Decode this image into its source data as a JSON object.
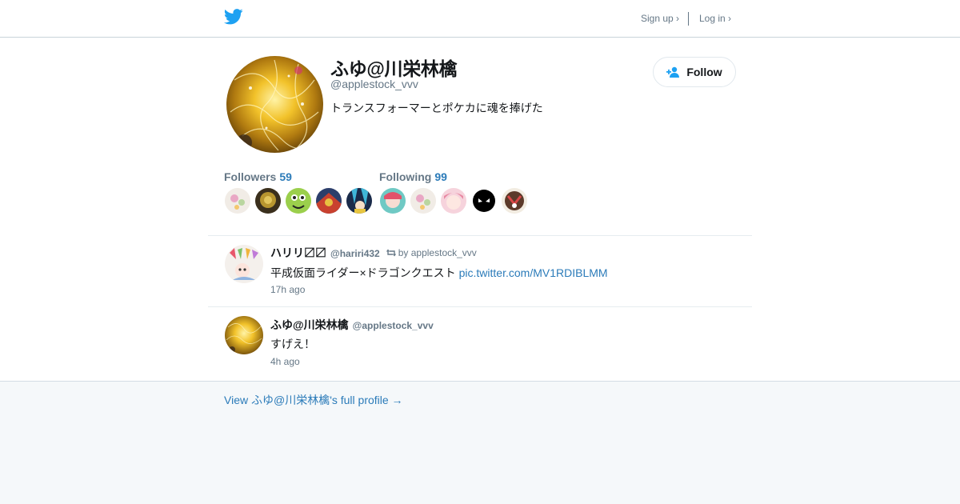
{
  "header": {
    "logo_icon": "twitter-bird-icon",
    "signup_label": "Sign up ›",
    "login_label": "Log in ›"
  },
  "profile": {
    "name": "ふゆ@川栄林檎",
    "handle": "@applestock_vvv",
    "bio": "トランスフォーマーとポケカに魂を捧げた",
    "follow_label": "Follow",
    "follow_icon": "add-user-icon"
  },
  "stats": {
    "followers_label": "Followers",
    "followers_count": "59",
    "following_label": "Following",
    "following_count": "99"
  },
  "tweets": [
    {
      "name": "ハリリ〼〼",
      "handle": "@hariri432",
      "retweet_label": "by applestock_vvv",
      "text": "平成仮面ライダー×ドラゴンクエスト",
      "link": "pic.twitter.com/MV1RDIBLMM",
      "time": "17h ago"
    },
    {
      "name": "ふゆ@川栄林檎",
      "handle": "@applestock_vvv",
      "text": "すげえ！",
      "time": "4h ago"
    }
  ],
  "footer": {
    "full_profile_link": "View ふゆ@川栄林檎's full profile →"
  },
  "colors": {
    "accent": "#2b7bb9",
    "muted": "#657786",
    "background": "#f5f8fa",
    "twitter_blue": "#1da1f2"
  }
}
